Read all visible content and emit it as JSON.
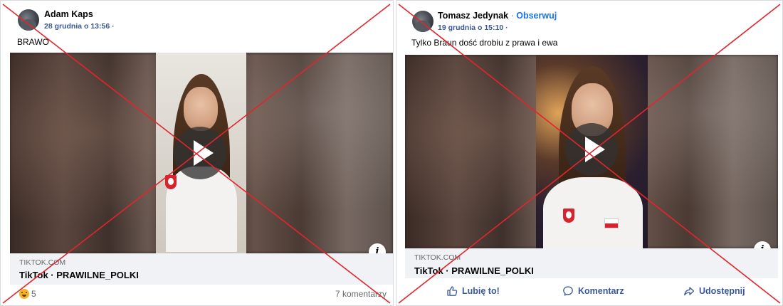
{
  "posts": [
    {
      "author": "Adam Kaps",
      "timestamp": "28 grudnia o 13:56 ·",
      "message": "BRAWO",
      "link": {
        "domain": "TIKTOK.COM",
        "title": "TikTok · PRAWILNE_POLKI"
      },
      "reactions": {
        "count": "5",
        "icon": "haha-reaction-icon"
      },
      "comments": "7 komentarzy"
    },
    {
      "author": "Tomasz Jedynak",
      "separator": " · ",
      "follow": "Obserwuj",
      "timestamp": "19 grudnia o 15:10 ·",
      "message": "Tylko Braun dość drobiu z prawa i ewa",
      "link": {
        "domain": "TIKTOK.COM",
        "title": "TikTok · PRAWILNE_POLKI"
      },
      "actions": {
        "like": "Lubię to!",
        "comment": "Komentarz",
        "share": "Udostępnij"
      }
    }
  ],
  "colors": {
    "accent": "#1b74e4",
    "link_blue": "#385898",
    "cross_red": "#e0262d"
  },
  "icons": {
    "play": "play-icon",
    "info": "info-icon",
    "like": "thumbs-up-icon",
    "comment": "comment-bubble-icon",
    "share": "share-arrow-icon"
  }
}
